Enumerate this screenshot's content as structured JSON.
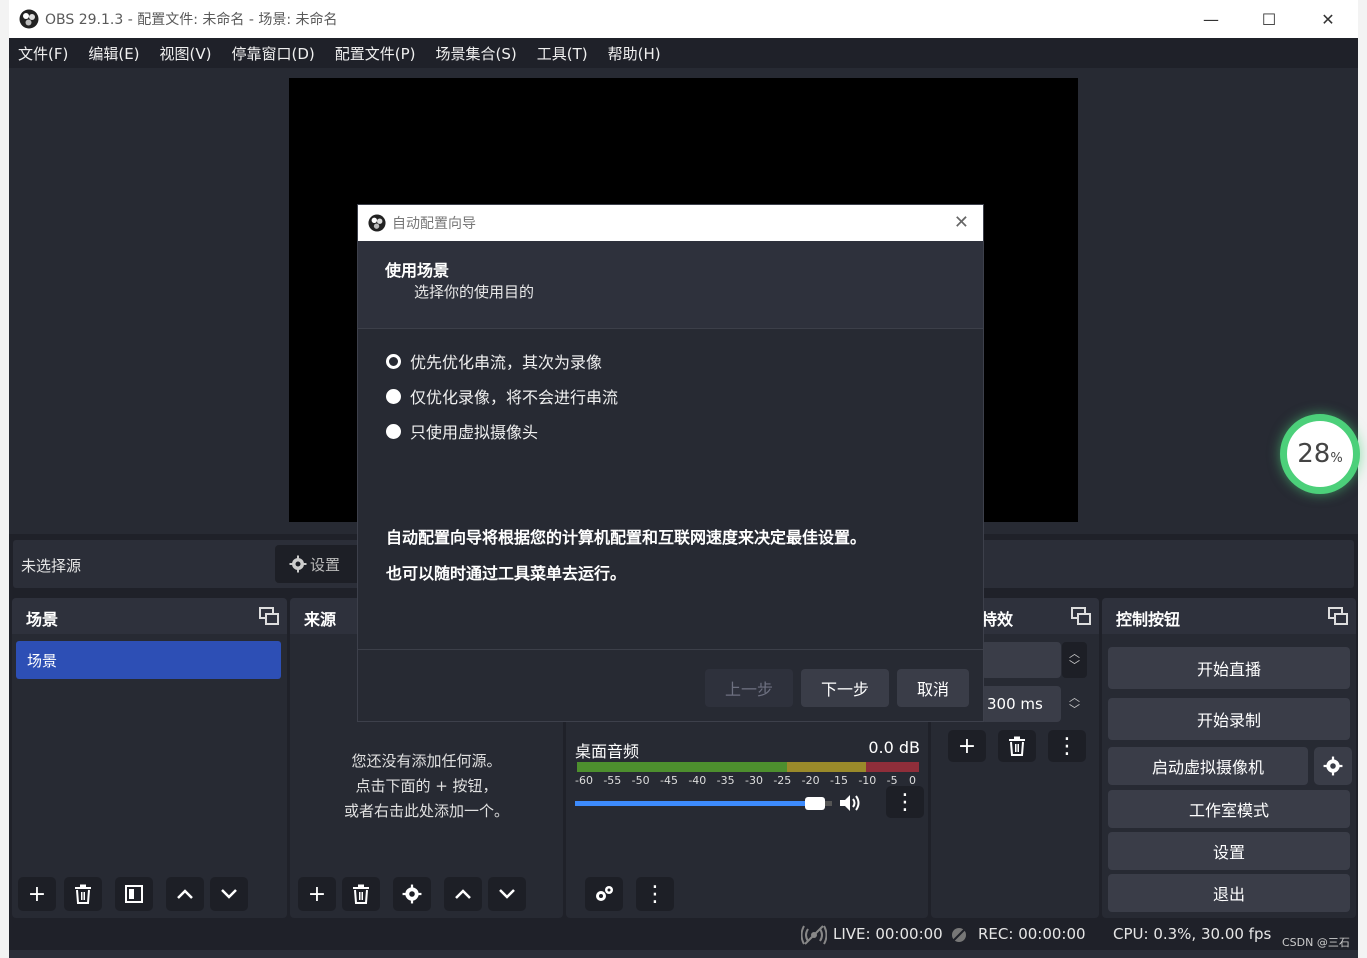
{
  "window": {
    "title": "OBS 29.1.3 - 配置文件: 未命名 - 场景: 未命名",
    "minimize": "—",
    "maximize": "☐",
    "close": "✕"
  },
  "menu": [
    "文件(F)",
    "编辑(E)",
    "视图(V)",
    "停靠窗口(D)",
    "配置文件(P)",
    "场景集合(S)",
    "工具(T)",
    "帮助(H)"
  ],
  "source_bar": {
    "no_source": "未选择源",
    "settings": "设置"
  },
  "scenes": {
    "title": "场景",
    "items": [
      "场景"
    ]
  },
  "sources": {
    "title": "来源",
    "empty_lines": [
      "您还没有添加任何源。",
      "点击下面的 + 按钮，",
      "或者右击此处添加一个。"
    ]
  },
  "mixer": {
    "track_name": "桌面音频",
    "level": "0.0 dB",
    "scale": [
      "-60",
      "-55",
      "-50",
      "-45",
      "-40",
      "-35",
      "-30",
      "-25",
      "-20",
      "-15",
      "-10",
      "-5",
      "0"
    ],
    "volume_fraction": 0.97
  },
  "transitions": {
    "title": "特效",
    "duration": "300 ms"
  },
  "controls": {
    "title": "控制按钮",
    "start_stream": "开始直播",
    "start_record": "开始录制",
    "start_virtualcam": "启动虚拟摄像机",
    "studio_mode": "工作室模式",
    "settings": "设置",
    "exit": "退出"
  },
  "status": {
    "live": "LIVE: 00:00:00",
    "rec": "REC: 00:00:00",
    "cpu": "CPU: 0.3%, 30.00 fps",
    "watermark": "CSDN @三石"
  },
  "dialog": {
    "title": "自动配置向导",
    "heading": "使用场景",
    "subheading": "选择你的使用目的",
    "options": [
      {
        "label": "优先优化串流，其次为录像",
        "selected": true
      },
      {
        "label": "仅优化录像，将不会进行串流",
        "selected": false
      },
      {
        "label": "只使用虚拟摄像头",
        "selected": false
      }
    ],
    "note1": "自动配置向导将根据您的计算机配置和互联网速度来决定最佳设置。",
    "note2": "也可以随时通过工具菜单去运行。",
    "back": "上一步",
    "next": "下一步",
    "cancel": "取消"
  },
  "overlay_gauge": {
    "value": "28",
    "unit": "%"
  },
  "colors": {
    "accent": "#2d4fb5",
    "meter_green": "#4d8f2e",
    "meter_yellow": "#9a8a2a",
    "meter_red": "#8f2e3a",
    "gauge_green": "#4cd07a"
  }
}
